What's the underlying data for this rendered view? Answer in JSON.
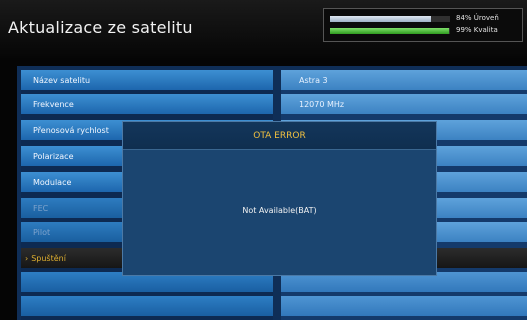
{
  "header": {
    "title": "Aktualizace ze satelitu"
  },
  "signal": {
    "level_text": "84% Úroveň",
    "level_value": 0.84,
    "quality_text": "99% Kvalita",
    "quality_value": 0.99
  },
  "rows": [
    {
      "label": "Název satelitu",
      "value": "Astra 3"
    },
    {
      "label": "Frekvence",
      "value": "12070 MHz"
    },
    {
      "label": "Přenosová rychlost",
      "value": ""
    },
    {
      "label": "Polarizace",
      "value": ""
    },
    {
      "label": "Modulace",
      "value": ""
    },
    {
      "label": "FEC",
      "value": ""
    },
    {
      "label": "Pilot",
      "value": ""
    },
    {
      "label": "Spuštění",
      "value": ""
    }
  ],
  "dialog": {
    "title": "OTA ERROR",
    "message": "Not Available(BAT)"
  },
  "colors": {
    "row_blue": "#2b78c0",
    "selected_text": "#e0b030",
    "dialog_bg": "#1b4570"
  }
}
